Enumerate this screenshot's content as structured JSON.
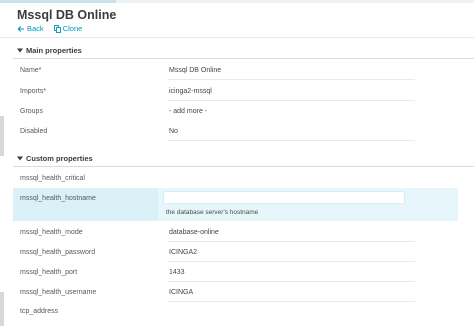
{
  "page": {
    "title": "Mssql DB Online",
    "actions": {
      "back_label": "Back",
      "clone_label": "Clone"
    }
  },
  "main_properties": {
    "heading": "Main properties",
    "name": {
      "label": "Name*",
      "value": "Mssql DB Online"
    },
    "imports": {
      "label": "Imports*",
      "value": "icinga2-mssql"
    },
    "groups": {
      "label": "Groups",
      "value": "- add more -"
    },
    "disabled": {
      "label": "Disabled",
      "value": "No"
    }
  },
  "custom_properties": {
    "heading": "Custom properties",
    "health_critical": {
      "label": "mssql_health_critical",
      "value": ""
    },
    "health_hostname": {
      "label": "mssql_health_hostname",
      "value": "",
      "hint": "the database server's hostname"
    },
    "health_mode": {
      "label": "mssql_health_mode",
      "value": "database-online"
    },
    "health_password": {
      "label": "mssql_health_password",
      "value": "ICINGA2"
    },
    "health_port": {
      "label": "mssql_health_port",
      "value": "1433"
    },
    "health_username": {
      "label": "mssql_health_username",
      "value": "ICINGA"
    },
    "tcp_address": {
      "label": "tcp_address",
      "value": ""
    }
  },
  "colors": {
    "accent": "#0095bf",
    "active_row": "#e7f6fb"
  }
}
